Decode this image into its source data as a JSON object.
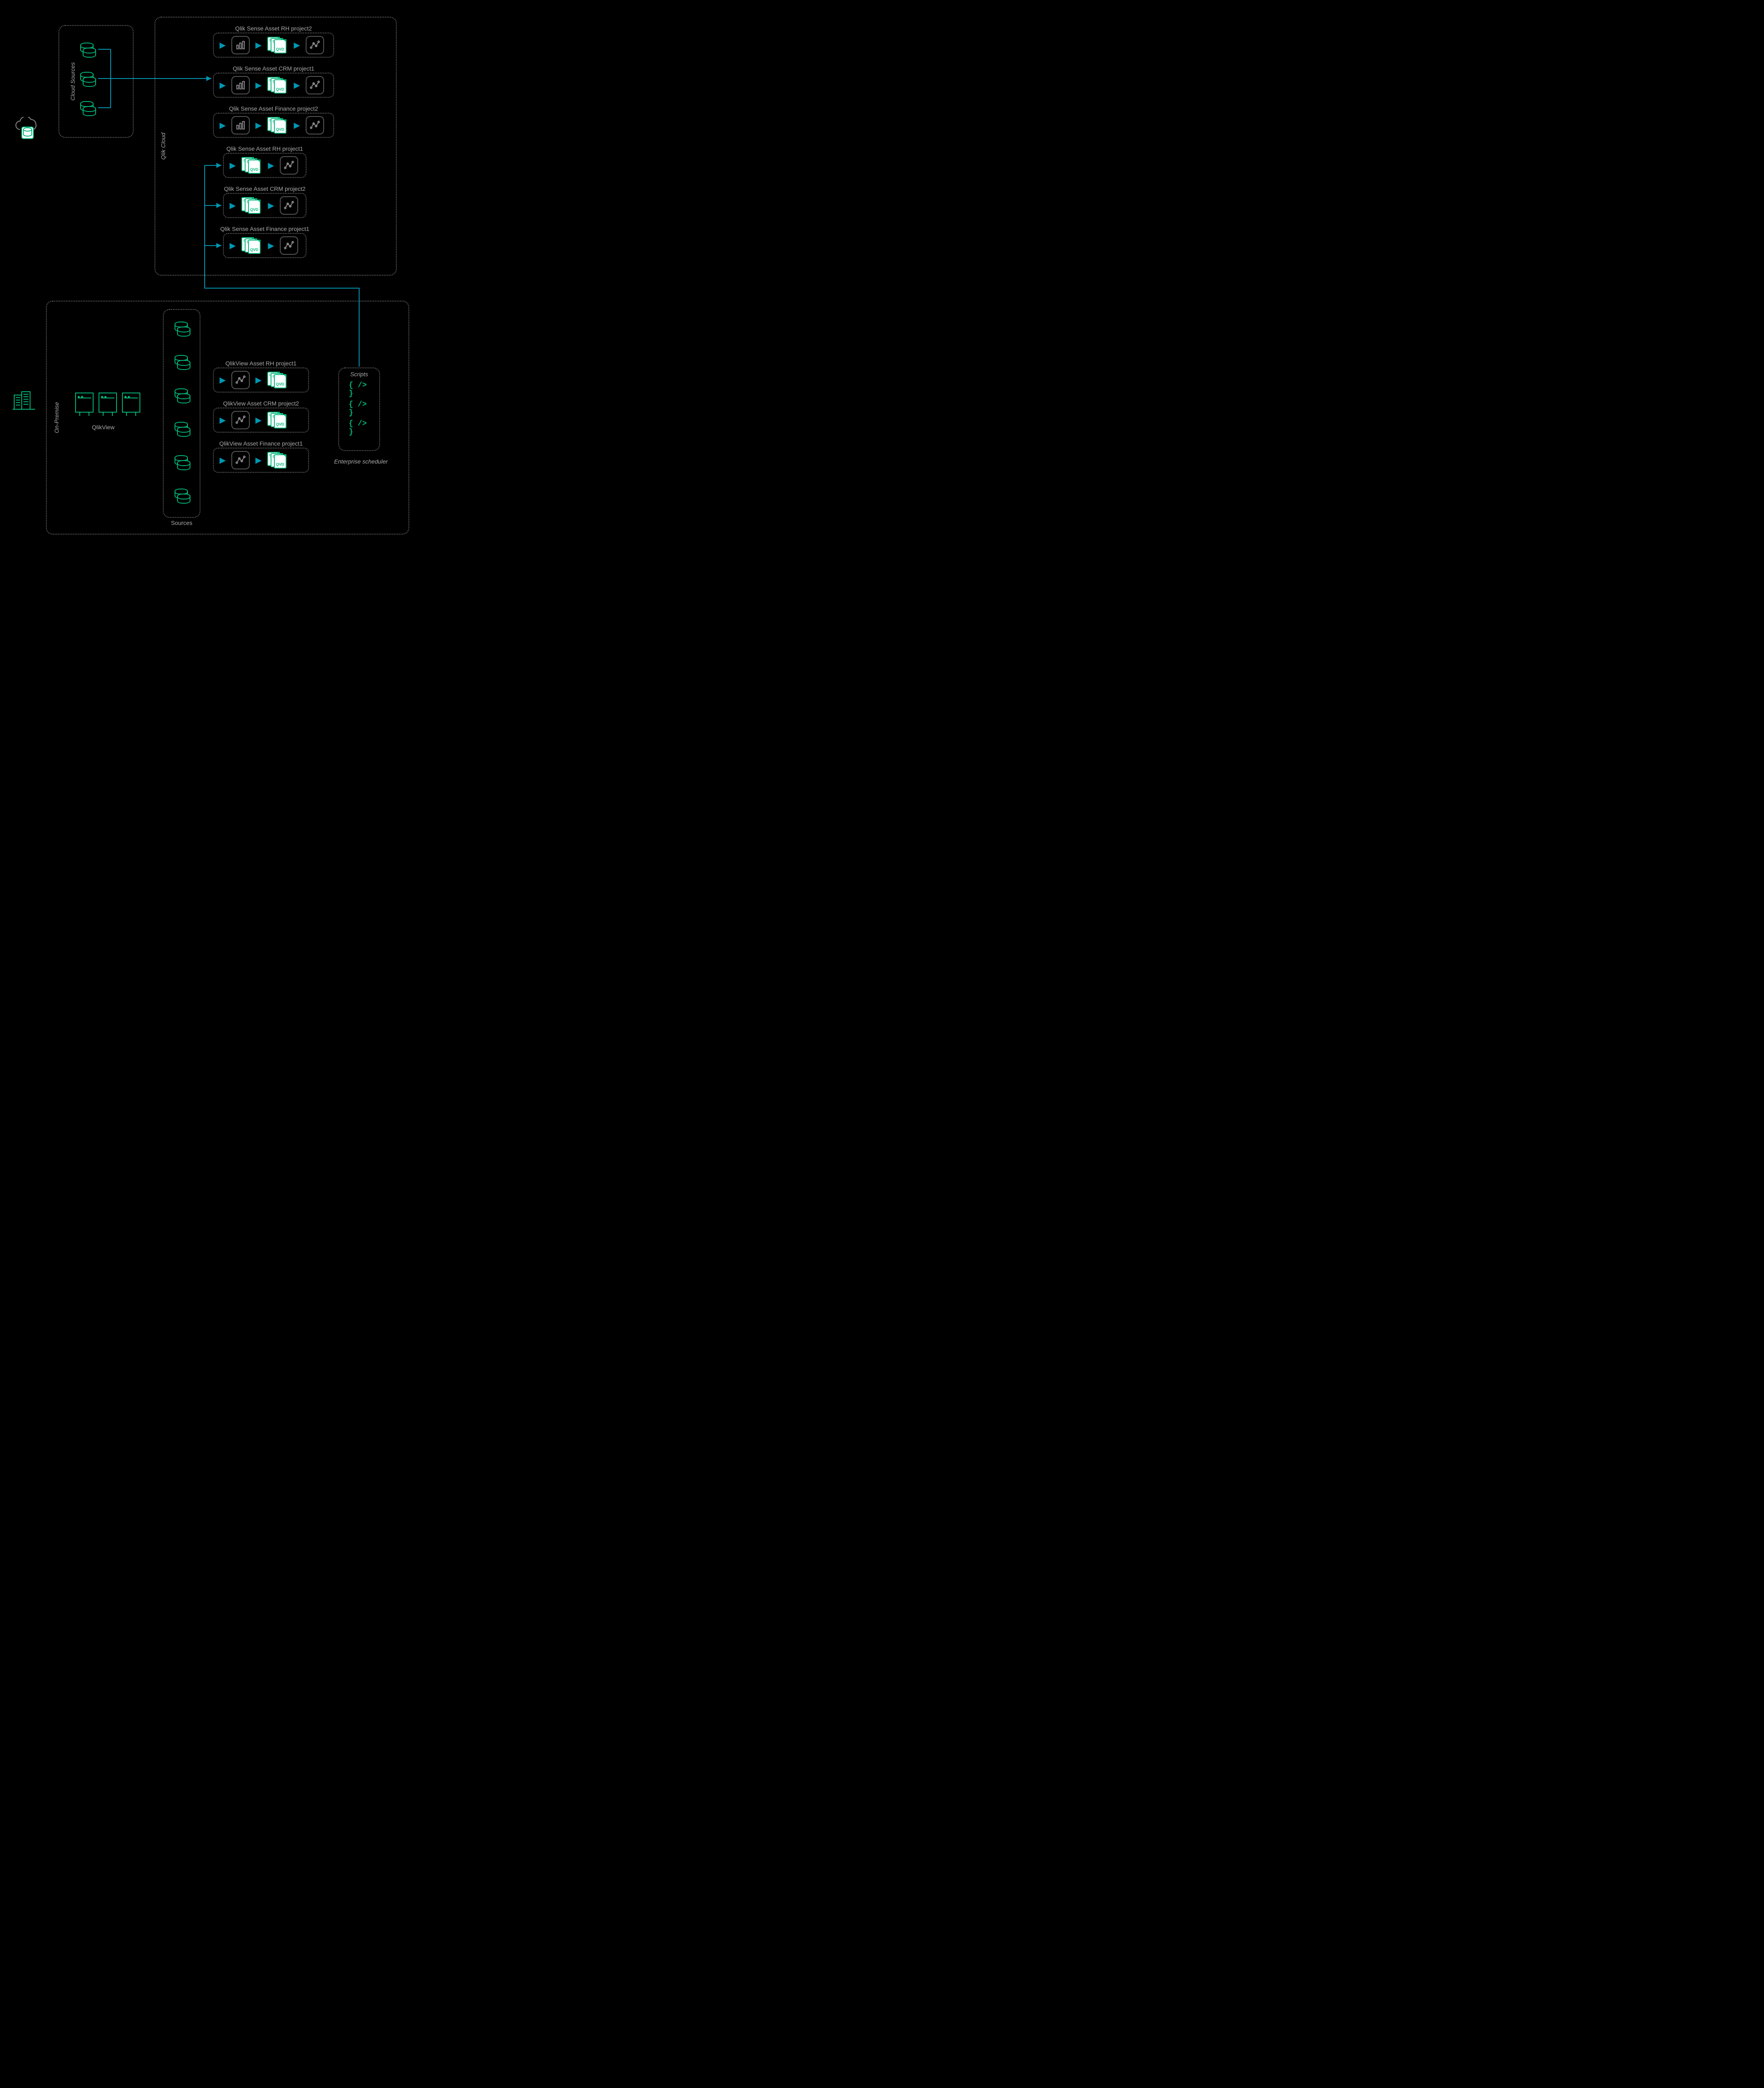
{
  "regions": {
    "cloud_sources_label": "Cloud Sources",
    "qlik_cloud_label": "Qlik Cloud",
    "on_premise_label": "On-Premise",
    "sources_label": "Sources",
    "scripts_title": "Scripts",
    "enterprise_scheduler_label": "Enterprise scheduler",
    "qlikview_label": "QlikView"
  },
  "qlik_cloud_assets": [
    {
      "title": "Qlik Sense Asset RH project2",
      "layout": "full"
    },
    {
      "title": "Qlik Sense Asset CRM project1",
      "layout": "full"
    },
    {
      "title": "Qlik Sense Asset Finance project2",
      "layout": "full"
    },
    {
      "title": "Qlik Sense Asset RH project1",
      "layout": "short"
    },
    {
      "title": "Qlik Sense Asset CRM project2",
      "layout": "short"
    },
    {
      "title": "Qlik Sense Asset Finance project1",
      "layout": "short"
    }
  ],
  "qlikview_assets": [
    {
      "title": "QlikView Asset RH project1"
    },
    {
      "title": "QlikView Asset CRM project2"
    },
    {
      "title": "QlikView Asset Finance project1"
    }
  ],
  "icons": {
    "qv_small": "QV",
    "qvd": "QVD",
    "script": "{ /> }"
  },
  "colors": {
    "accent_teal": "#0097b2",
    "accent_green": "#00b67a",
    "line_grey": "#666666",
    "text_grey": "#aaaaaa"
  }
}
